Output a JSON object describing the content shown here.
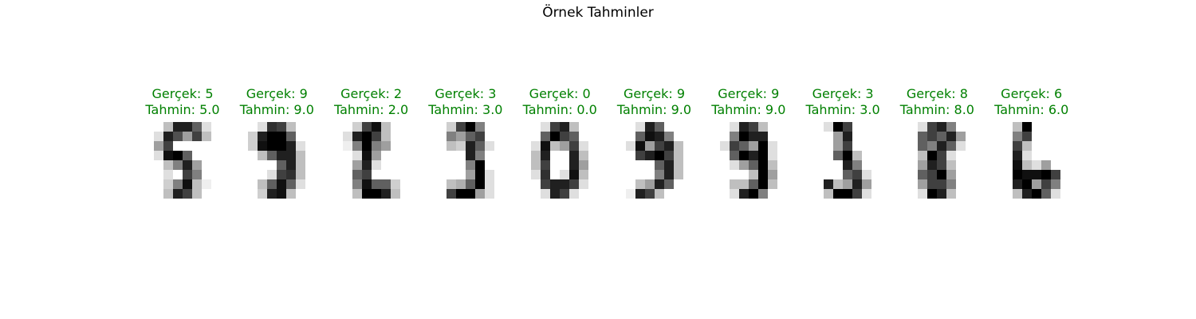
{
  "figure": {
    "title": "Örnek Tahminler",
    "label_color": "#008000"
  },
  "samples": [
    {
      "true_label": "Gerçek: 5",
      "pred_label": "Tahmin: 5.0",
      "true": 5,
      "pred": 5.0,
      "pixels": [
        [
          0,
          0,
          4,
          14,
          14,
          10,
          2,
          0
        ],
        [
          0,
          2,
          14,
          11,
          6,
          12,
          4,
          0
        ],
        [
          0,
          6,
          12,
          0,
          0,
          0,
          0,
          0
        ],
        [
          0,
          2,
          15,
          16,
          10,
          0,
          0,
          0
        ],
        [
          0,
          0,
          4,
          8,
          14,
          6,
          0,
          0
        ],
        [
          0,
          0,
          2,
          0,
          12,
          8,
          0,
          0
        ],
        [
          0,
          0,
          3,
          8,
          15,
          4,
          1,
          0
        ],
        [
          0,
          0,
          4,
          14,
          12,
          4,
          0,
          0
        ]
      ]
    },
    {
      "true_label": "Gerçek: 9",
      "pred_label": "Tahmin: 9.0",
      "true": 9,
      "pred": 9.0,
      "pixels": [
        [
          0,
          0,
          2,
          13,
          12,
          4,
          0,
          0
        ],
        [
          0,
          3,
          14,
          16,
          16,
          10,
          0,
          0
        ],
        [
          0,
          3,
          15,
          16,
          16,
          14,
          2,
          0
        ],
        [
          0,
          0,
          4,
          10,
          14,
          14,
          4,
          0
        ],
        [
          0,
          0,
          0,
          0,
          10,
          14,
          4,
          0
        ],
        [
          0,
          0,
          0,
          2,
          12,
          13,
          4,
          0
        ],
        [
          0,
          0,
          4,
          10,
          15,
          10,
          2,
          0
        ],
        [
          0,
          0,
          3,
          14,
          15,
          4,
          0,
          0
        ]
      ]
    },
    {
      "true_label": "Gerçek: 2",
      "pred_label": "Tahmin: 2.0",
      "true": 2,
      "pred": 2.0,
      "pixels": [
        [
          0,
          0,
          3,
          12,
          15,
          4,
          0,
          0
        ],
        [
          0,
          2,
          14,
          16,
          12,
          4,
          0,
          0
        ],
        [
          0,
          1,
          8,
          16,
          8,
          6,
          0,
          0
        ],
        [
          0,
          0,
          2,
          15,
          6,
          0,
          0,
          0
        ],
        [
          0,
          0,
          6,
          14,
          2,
          0,
          0,
          0
        ],
        [
          0,
          0,
          10,
          12,
          0,
          0,
          0,
          0
        ],
        [
          0,
          0,
          8,
          15,
          10,
          10,
          3,
          0
        ],
        [
          0,
          0,
          4,
          16,
          16,
          14,
          4,
          0
        ]
      ]
    },
    {
      "true_label": "Gerçek: 3",
      "pred_label": "Tahmin: 3.0",
      "true": 3,
      "pred": 3.0,
      "pixels": [
        [
          0,
          0,
          3,
          12,
          16,
          8,
          0,
          0
        ],
        [
          0,
          0,
          8,
          6,
          10,
          12,
          0,
          0
        ],
        [
          0,
          0,
          4,
          3,
          14,
          10,
          2,
          0
        ],
        [
          0,
          0,
          0,
          0,
          14,
          8,
          0,
          0
        ],
        [
          0,
          0,
          0,
          0,
          8,
          16,
          0,
          0
        ],
        [
          0,
          0,
          0,
          0,
          6,
          16,
          2,
          0
        ],
        [
          0,
          0,
          4,
          5,
          10,
          16,
          2,
          0
        ],
        [
          0,
          0,
          12,
          16,
          16,
          6,
          2,
          0
        ]
      ]
    },
    {
      "true_label": "Gerçek: 0",
      "pred_label": "Tahmin: 0.0",
      "true": 0,
      "pred": 0.0,
      "pixels": [
        [
          0,
          0,
          2,
          12,
          14,
          4,
          0,
          0
        ],
        [
          0,
          0,
          10,
          16,
          12,
          10,
          0,
          0
        ],
        [
          0,
          2,
          15,
          4,
          6,
          12,
          2,
          0
        ],
        [
          0,
          4,
          14,
          0,
          0,
          14,
          4,
          0
        ],
        [
          0,
          4,
          12,
          0,
          0,
          14,
          6,
          0
        ],
        [
          0,
          2,
          13,
          0,
          2,
          15,
          4,
          0
        ],
        [
          0,
          0,
          12,
          14,
          14,
          12,
          2,
          0
        ],
        [
          0,
          0,
          2,
          14,
          12,
          2,
          0,
          0
        ]
      ]
    },
    {
      "true_label": "Gerçek: 9",
      "pred_label": "Tahmin: 9.0",
      "true": 9,
      "pred": 9.0,
      "pixels": [
        [
          0,
          0,
          2,
          14,
          10,
          0,
          0,
          0
        ],
        [
          0,
          0,
          10,
          15,
          14,
          8,
          0,
          0
        ],
        [
          0,
          2,
          15,
          6,
          12,
          14,
          4,
          0
        ],
        [
          0,
          0,
          12,
          14,
          16,
          12,
          4,
          0
        ],
        [
          0,
          0,
          0,
          0,
          10,
          14,
          4,
          0
        ],
        [
          0,
          0,
          0,
          0,
          8,
          14,
          4,
          0
        ],
        [
          0,
          0,
          4,
          6,
          14,
          10,
          0,
          0
        ],
        [
          0,
          1,
          14,
          12,
          4,
          0,
          0,
          0
        ]
      ]
    },
    {
      "true_label": "Gerçek: 9",
      "pred_label": "Tahmin: 9.0",
      "true": 9,
      "pred": 9.0,
      "pixels": [
        [
          0,
          0,
          2,
          14,
          12,
          4,
          0,
          0
        ],
        [
          0,
          0,
          8,
          16,
          14,
          14,
          0,
          0
        ],
        [
          0,
          2,
          12,
          10,
          6,
          16,
          2,
          0
        ],
        [
          0,
          0,
          10,
          16,
          14,
          16,
          2,
          0
        ],
        [
          0,
          0,
          2,
          6,
          10,
          16,
          4,
          0
        ],
        [
          0,
          0,
          0,
          0,
          4,
          16,
          6,
          0
        ],
        [
          0,
          0,
          4,
          4,
          10,
          16,
          4,
          0
        ],
        [
          0,
          0,
          2,
          14,
          16,
          8,
          0,
          0
        ]
      ]
    },
    {
      "true_label": "Gerçek: 3",
      "pred_label": "Tahmin: 3.0",
      "true": 3,
      "pred": 3.0,
      "pixels": [
        [
          0,
          0,
          2,
          16,
          12,
          0,
          0,
          0
        ],
        [
          0,
          0,
          0,
          6,
          14,
          0,
          0,
          0
        ],
        [
          0,
          0,
          0,
          6,
          12,
          0,
          0,
          0
        ],
        [
          0,
          0,
          0,
          10,
          16,
          4,
          0,
          0
        ],
        [
          0,
          0,
          0,
          0,
          14,
          8,
          0,
          0
        ],
        [
          0,
          0,
          0,
          0,
          10,
          12,
          2,
          0
        ],
        [
          0,
          0,
          14,
          4,
          6,
          14,
          6,
          0
        ],
        [
          0,
          0,
          4,
          16,
          16,
          12,
          2,
          0
        ]
      ]
    },
    {
      "true_label": "Gerçek: 8",
      "pred_label": "Tahmin: 8.0",
      "true": 8,
      "pred": 8.0,
      "pixels": [
        [
          0,
          0,
          2,
          12,
          14,
          8,
          0,
          0
        ],
        [
          0,
          0,
          10,
          12,
          10,
          14,
          6,
          0
        ],
        [
          0,
          0,
          10,
          8,
          14,
          10,
          2,
          0
        ],
        [
          0,
          0,
          4,
          16,
          12,
          2,
          0,
          0
        ],
        [
          0,
          0,
          6,
          14,
          12,
          4,
          0,
          0
        ],
        [
          0,
          0,
          10,
          12,
          16,
          6,
          0,
          0
        ],
        [
          0,
          0,
          6,
          12,
          12,
          8,
          0,
          0
        ],
        [
          0,
          0,
          2,
          16,
          14,
          4,
          0,
          0
        ]
      ]
    },
    {
      "true_label": "Gerçek: 6",
      "pred_label": "Tahmin: 6.0",
      "true": 6,
      "pred": 6.0,
      "pixels": [
        [
          0,
          0,
          4,
          16,
          0,
          0,
          0,
          0
        ],
        [
          0,
          0,
          8,
          12,
          0,
          0,
          0,
          0
        ],
        [
          0,
          0,
          12,
          4,
          0,
          0,
          0,
          0
        ],
        [
          0,
          0,
          14,
          2,
          0,
          0,
          0,
          0
        ],
        [
          0,
          0,
          15,
          4,
          2,
          6,
          0,
          0
        ],
        [
          0,
          0,
          16,
          15,
          15,
          16,
          12,
          0
        ],
        [
          0,
          0,
          14,
          16,
          6,
          12,
          8,
          0
        ],
        [
          0,
          0,
          4,
          14,
          16,
          10,
          2,
          0
        ]
      ]
    }
  ]
}
